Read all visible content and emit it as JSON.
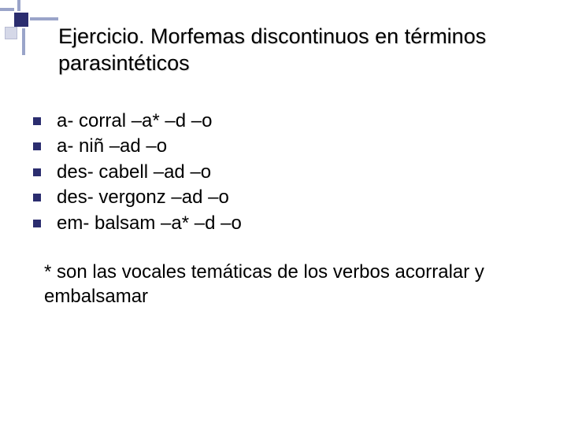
{
  "title": "Ejercicio. Morfemas discontinuos en términos parasintéticos",
  "items": [
    "a- corral –a* –d –o",
    "a- niñ –ad –o",
    "des- cabell –ad –o",
    "des- vergonz –ad –o",
    "em- balsam –a* –d –o"
  ],
  "footnote": "* son las vocales temáticas de los verbos acorralar y embalsamar"
}
